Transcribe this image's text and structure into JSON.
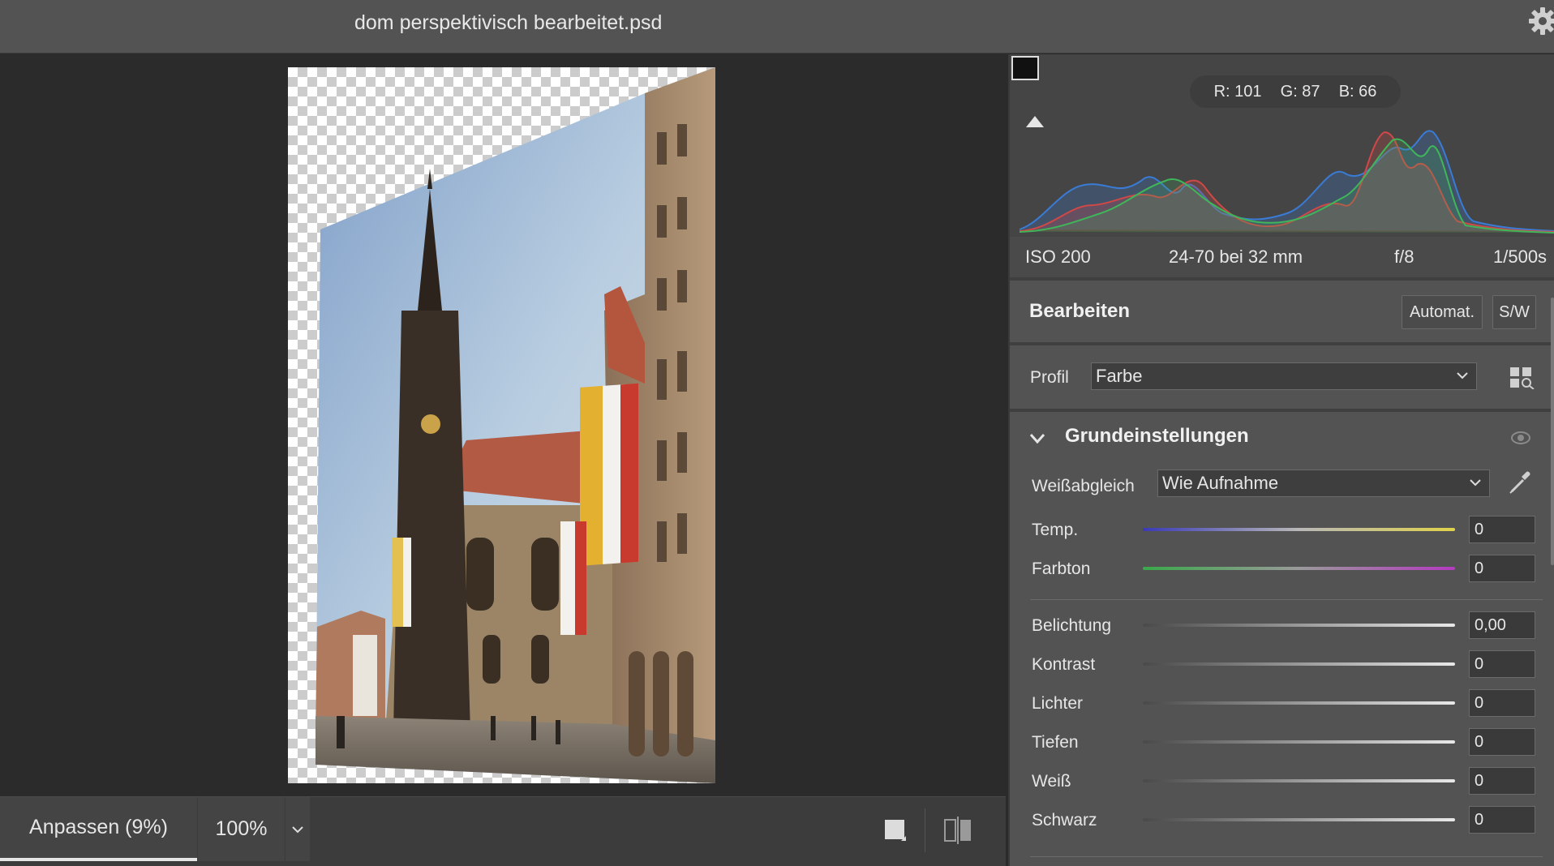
{
  "window": {
    "title": "dom perspektivisch bearbeitet.psd"
  },
  "bottombar": {
    "fit_label": "Anpassen (9%)",
    "zoom_label": "100%"
  },
  "histogram": {
    "readout": {
      "r": "R: 101",
      "g": "G: 87",
      "b": "B: 66"
    }
  },
  "metadata": {
    "iso": "ISO 200",
    "lens": "24-70 bei 32 mm",
    "aperture": "f/8",
    "shutter": "1/500s"
  },
  "edit": {
    "title": "Bearbeiten",
    "auto_label": "Automat.",
    "bw_label": "S/W",
    "profile_label": "Profil",
    "profile_value": "Farbe"
  },
  "basic": {
    "title": "Grundeinstellungen",
    "wb_label": "Weißabgleich",
    "wb_value": "Wie Aufnahme",
    "sliders": [
      {
        "label": "Temp.",
        "value": "0"
      },
      {
        "label": "Farbton",
        "value": "0"
      },
      {
        "label": "Belichtung",
        "value": "0,00"
      },
      {
        "label": "Kontrast",
        "value": "0"
      },
      {
        "label": "Lichter",
        "value": "0"
      },
      {
        "label": "Tiefen",
        "value": "0"
      },
      {
        "label": "Weiß",
        "value": "0"
      },
      {
        "label": "Schwarz",
        "value": "0"
      }
    ]
  },
  "colors": {
    "accent": "#e6e6e6",
    "panel": "#535353",
    "canvas": "#2b2b2b"
  }
}
